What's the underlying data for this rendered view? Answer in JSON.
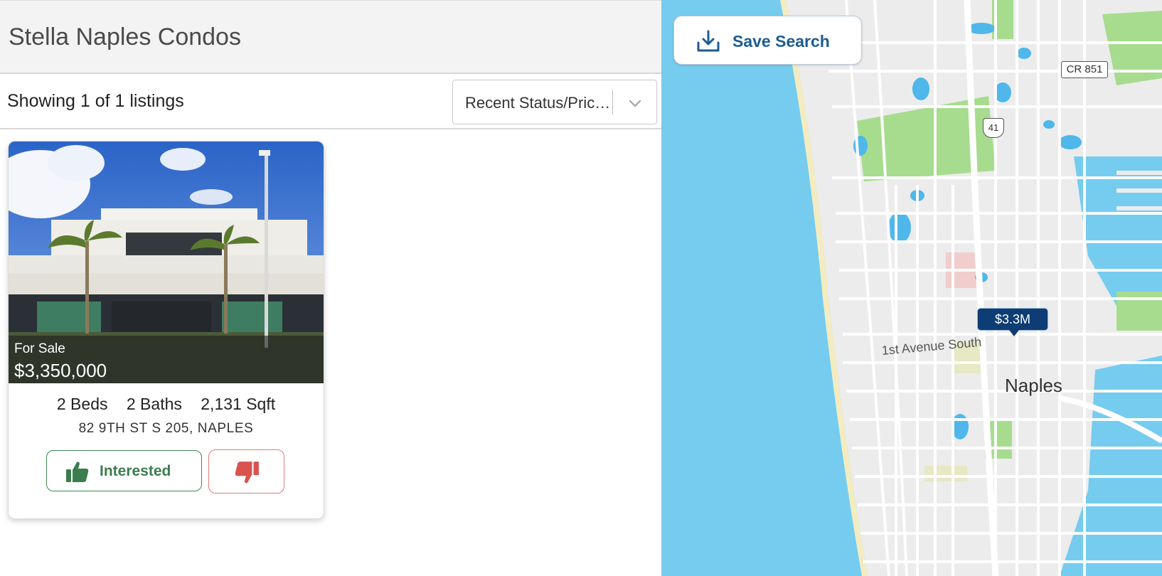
{
  "header": {
    "title": "Stella Naples Condos"
  },
  "results": {
    "count_text": "Showing 1 of 1 listings"
  },
  "sort": {
    "selected": "Recent Status/Price Change"
  },
  "listing": {
    "status": "For Sale",
    "price": "$3,350,000",
    "beds": "2 Beds",
    "baths": "2 Baths",
    "sqft": "2,131 Sqft",
    "address": "82 9TH ST S 205, NAPLES",
    "interested_label": "Interested"
  },
  "map": {
    "save_search_label": "Save Search",
    "price_pin": "$3.3M",
    "city_label": "Naples",
    "street_label": "1st Avenue South",
    "road_shield_cr": "CR 851",
    "road_shield_us": "41",
    "colors": {
      "water": "#75ccef",
      "land": "#ececec",
      "park": "#a7dc8f",
      "pin": "#0d3d74"
    }
  },
  "icons": {
    "sort_chevron": "chevron-down-icon",
    "interested": "thumbs-up-icon",
    "not_interested": "thumbs-down-icon",
    "save_search": "download-icon"
  },
  "colors": {
    "interested": "#3b7d4d",
    "not_interested": "#d9534f",
    "accent_blue": "#1d5c92"
  }
}
